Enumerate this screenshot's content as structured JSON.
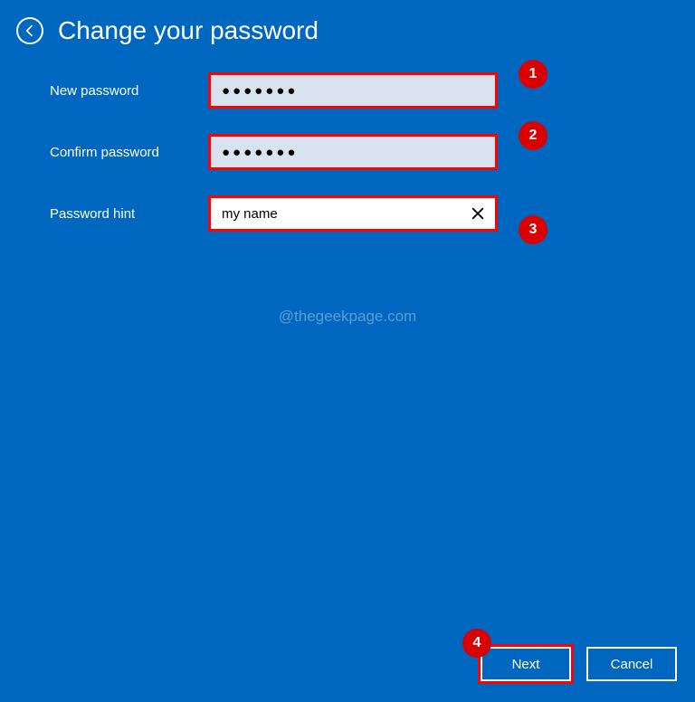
{
  "header": {
    "title": "Change your password"
  },
  "form": {
    "new_password": {
      "label": "New password",
      "value": "●●●●●●●"
    },
    "confirm_password": {
      "label": "Confirm password",
      "value": "●●●●●●●"
    },
    "password_hint": {
      "label": "Password hint",
      "value": "my name"
    }
  },
  "badges": {
    "b1": "1",
    "b2": "2",
    "b3": "3",
    "b4": "4"
  },
  "watermark": "@thegeekpage.com",
  "footer": {
    "next": "Next",
    "cancel": "Cancel"
  }
}
